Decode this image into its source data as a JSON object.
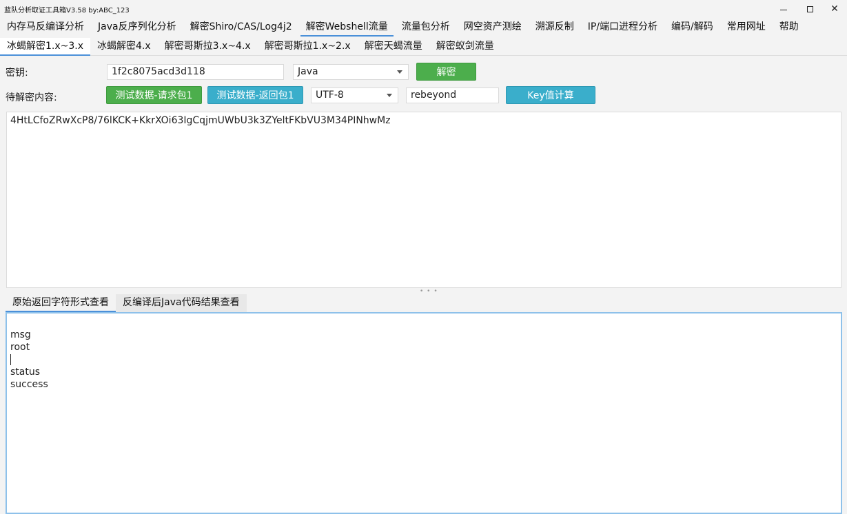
{
  "window": {
    "title": "蓝队分析取证工具箱V3.58 by:ABC_123",
    "controls": {
      "minimize": "–",
      "close": "✕"
    }
  },
  "menu": {
    "items": [
      "内存马反编译分析",
      "Java反序列化分析",
      "解密Shiro/CAS/Log4j2",
      "解密Webshell流量",
      "流量包分析",
      "网空资产测绘",
      "溯源反制",
      "IP/端口进程分析",
      "编码/解码",
      "常用网址",
      "帮助"
    ],
    "active_index": 3
  },
  "subtabs": {
    "items": [
      "冰蝎解密1.x~3.x",
      "冰蝎解密4.x",
      "解密哥斯拉3.x~4.x",
      "解密哥斯拉1.x~2.x",
      "解密天蝎流量",
      "解密蚁剑流量"
    ],
    "active_index": 0
  },
  "form": {
    "key_label": "密钥:",
    "key_value": "1f2c8075acd3d118",
    "lang_select": "Java",
    "decrypt_button": "解密",
    "content_label": "待解密内容:",
    "test_request_button": "测试数据-请求包1",
    "test_response_button": "测试数据-返回包1",
    "encoding_select": "UTF-8",
    "password_value": "rebeyond",
    "key_calc_button": "Key值计算"
  },
  "input_content": "4HtLCfoZRwXcP8/76lKCK+KkrXOi63IgCqjmUWbU3k3ZYeltFKbVU3M34PINhwMz",
  "output_tabs": {
    "items": [
      "原始返回字符形式查看",
      "反编译后Java代码结果查看"
    ],
    "active_index": 0
  },
  "output_lines": [
    "msg",
    "root",
    "",
    "status",
    "success"
  ]
}
